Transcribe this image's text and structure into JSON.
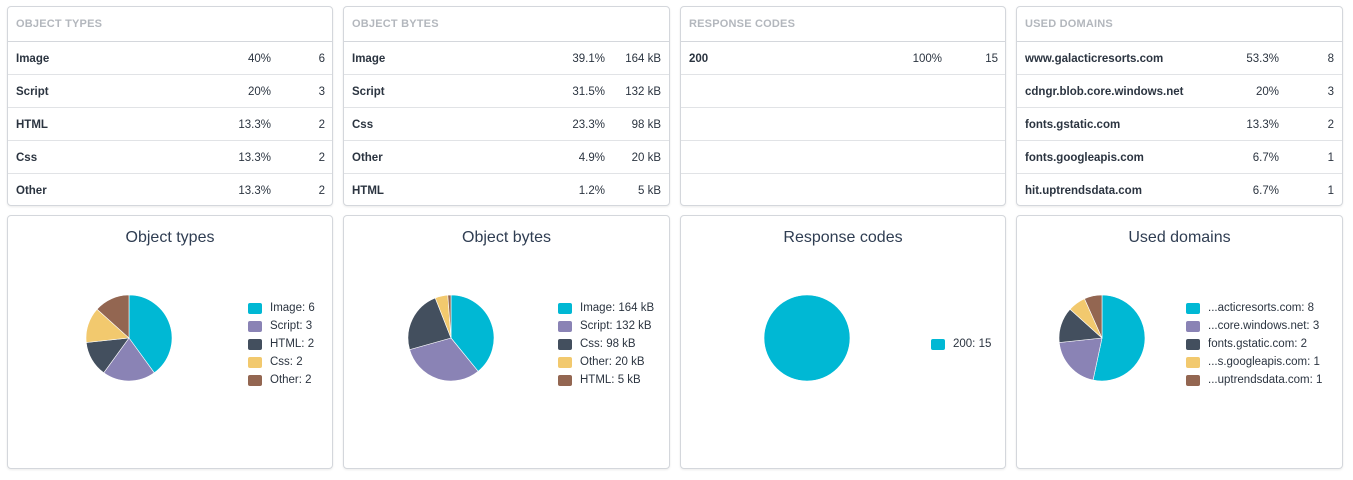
{
  "colors": {
    "image": "#00b8d4",
    "script": "#8a83b5",
    "html": "#434f5e",
    "css": "#f2c96e",
    "other": "#936651"
  },
  "tables": {
    "object_types": {
      "title": "OBJECT TYPES",
      "rows": [
        {
          "label": "Image",
          "pct": "40%",
          "count": "6"
        },
        {
          "label": "Script",
          "pct": "20%",
          "count": "3"
        },
        {
          "label": "HTML",
          "pct": "13.3%",
          "count": "2"
        },
        {
          "label": "Css",
          "pct": "13.3%",
          "count": "2"
        },
        {
          "label": "Other",
          "pct": "13.3%",
          "count": "2"
        }
      ]
    },
    "object_bytes": {
      "title": "OBJECT BYTES",
      "rows": [
        {
          "label": "Image",
          "pct": "39.1%",
          "count": "164 kB"
        },
        {
          "label": "Script",
          "pct": "31.5%",
          "count": "132 kB"
        },
        {
          "label": "Css",
          "pct": "23.3%",
          "count": "98 kB"
        },
        {
          "label": "Other",
          "pct": "4.9%",
          "count": "20 kB"
        },
        {
          "label": "HTML",
          "pct": "1.2%",
          "count": "5 kB"
        }
      ]
    },
    "response_codes": {
      "title": "RESPONSE CODES",
      "rows": [
        {
          "label": "200",
          "pct": "100%",
          "count": "15"
        }
      ]
    },
    "used_domains": {
      "title": "USED DOMAINS",
      "rows": [
        {
          "label": "www.galacticresorts.com",
          "pct": "53.3%",
          "count": "8"
        },
        {
          "label": "cdngr.blob.core.windows.net",
          "pct": "20%",
          "count": "3"
        },
        {
          "label": "fonts.gstatic.com",
          "pct": "13.3%",
          "count": "2"
        },
        {
          "label": "fonts.googleapis.com",
          "pct": "6.7%",
          "count": "1"
        },
        {
          "label": "hit.uptrendsdata.com",
          "pct": "6.7%",
          "count": "1"
        }
      ]
    }
  },
  "chart_data": [
    {
      "type": "pie",
      "title": "Object types",
      "slices": [
        {
          "label": "Image: 6",
          "value": 6,
          "color": "#00b8d4"
        },
        {
          "label": "Script: 3",
          "value": 3,
          "color": "#8a83b5"
        },
        {
          "label": "HTML: 2",
          "value": 2,
          "color": "#434f5e"
        },
        {
          "label": "Css: 2",
          "value": 2,
          "color": "#f2c96e"
        },
        {
          "label": "Other: 2",
          "value": 2,
          "color": "#936651"
        }
      ]
    },
    {
      "type": "pie",
      "title": "Object bytes",
      "slices": [
        {
          "label": "Image: 164 kB",
          "value": 164,
          "color": "#00b8d4"
        },
        {
          "label": "Script: 132 kB",
          "value": 132,
          "color": "#8a83b5"
        },
        {
          "label": "Css: 98 kB",
          "value": 98,
          "color": "#434f5e"
        },
        {
          "label": "Other: 20 kB",
          "value": 20,
          "color": "#f2c96e"
        },
        {
          "label": "HTML: 5 kB",
          "value": 5,
          "color": "#936651"
        }
      ]
    },
    {
      "type": "pie",
      "title": "Response codes",
      "slices": [
        {
          "label": "200: 15",
          "value": 15,
          "color": "#00b8d4"
        }
      ]
    },
    {
      "type": "pie",
      "title": "Used domains",
      "slices": [
        {
          "label": "...acticresorts.com: 8",
          "value": 8,
          "color": "#00b8d4"
        },
        {
          "label": "...core.windows.net: 3",
          "value": 3,
          "color": "#8a83b5"
        },
        {
          "label": "fonts.gstatic.com: 2",
          "value": 2,
          "color": "#434f5e"
        },
        {
          "label": "...s.googleapis.com: 1",
          "value": 1,
          "color": "#f2c96e"
        },
        {
          "label": "...uptrendsdata.com: 1",
          "value": 1,
          "color": "#936651"
        }
      ]
    }
  ]
}
